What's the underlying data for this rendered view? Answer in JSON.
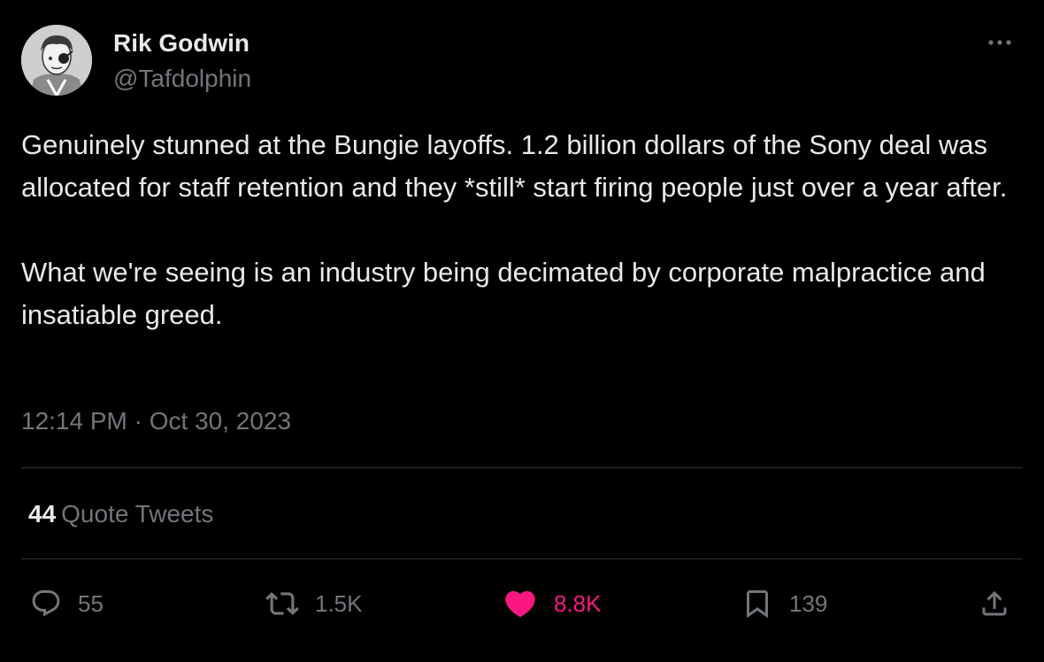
{
  "author": {
    "name": "Rik Godwin",
    "handle": "@Tafdolphin",
    "avatar_icon": "avatar-illustration"
  },
  "menu_icon": "more-dots-icon",
  "tweet": {
    "paragraphs": [
      "Genuinely stunned at the Bungie layoffs. 1.2 billion dollars of the Sony deal was allocated for staff retention and they *still* start firing people just over a year after.",
      "What we're seeing is an industry being decimated by corporate malpractice and insatiable greed."
    ]
  },
  "meta": {
    "time": "12:14 PM",
    "separator": "·",
    "date": "Oct 30, 2023"
  },
  "stats": {
    "quote_count": "44",
    "quote_label": "Quote Tweets"
  },
  "actions": {
    "reply_count": "55",
    "retweet_count": "1.5K",
    "like_count": "8.8K",
    "bookmark_count": "139"
  },
  "colors": {
    "background": "#000000",
    "text": "#e7e9ea",
    "secondary_text": "#71767b",
    "divider": "#2f3336",
    "like_accent": "#f91880"
  }
}
